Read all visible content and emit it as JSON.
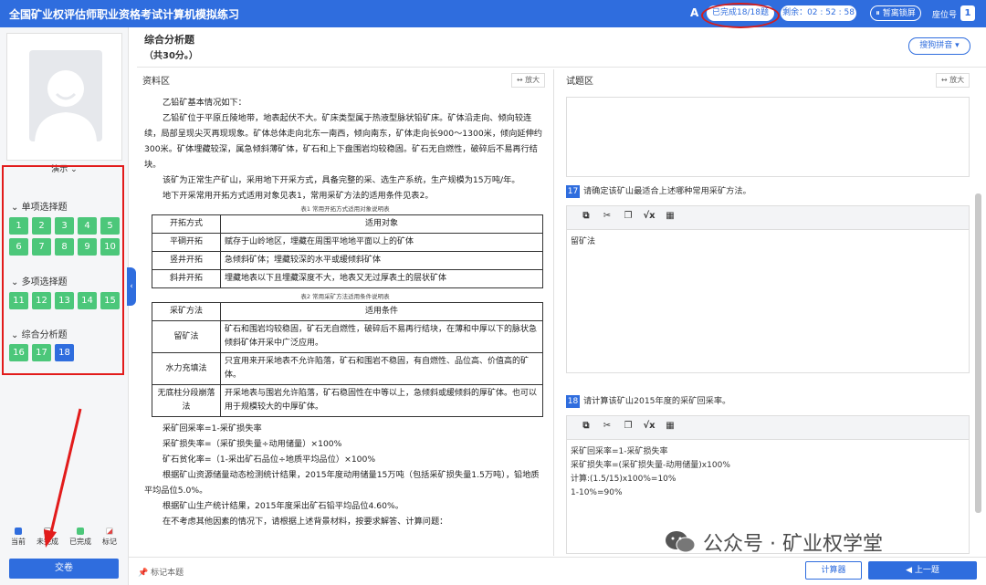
{
  "header": {
    "title": "全国矿业权评估师职业资格考试计算机模拟练习",
    "font_icon": "A",
    "progress": "已完成18/18题",
    "timer": "剩余：02 : 52 : 58",
    "pause": "暂离锁屏",
    "seat_label": "座位号",
    "seat_number": "1"
  },
  "sidebar": {
    "user_name": "演示",
    "sections": [
      {
        "title": "单项选择题",
        "items": [
          "1",
          "2",
          "3",
          "4",
          "5",
          "6",
          "7",
          "8",
          "9",
          "10"
        ]
      },
      {
        "title": "多项选择题",
        "items": [
          "11",
          "12",
          "13",
          "14",
          "15"
        ]
      },
      {
        "title": "综合分析题",
        "items": [
          "16",
          "17",
          "18"
        ]
      }
    ],
    "current_item": "18",
    "legend": [
      "当前",
      "未完成",
      "已完成",
      "标记"
    ],
    "submit": "交卷",
    "colors": {
      "current": "#2f6dde",
      "done": "#4cc77a",
      "highlight": "#e21b1b"
    }
  },
  "question_header": {
    "type": "综合分析题",
    "score": "（共30分。）",
    "ime": "搜狗拼音"
  },
  "material": {
    "label": "资料区",
    "zoom": "放大",
    "paragraphs": [
      "乙铅矿基本情况如下：",
      "乙铅矿位于平原丘陵地带，地表起伏不大。矿床类型属于热液型脉状铅矿床。矿体沿走向、倾向较连续，局部呈现尖灭再现现象。矿体总体走向北东一南西，倾向南东，矿体走向长900～1300米，倾向延伸约300米。矿体埋藏较深，属急倾斜薄矿体，矿石和上下盘围岩均较稳固。矿石无自燃性，破碎后不易再行结块。",
      "该矿为正常生产矿山，采用地下开采方式，具备完整的采、选生产系统，生产规模为15万吨/年。",
      "地下开采常用开拓方式适用对象见表1，常用采矿方法的适用条件见表2。"
    ],
    "table1": {
      "caption": "表1  常用开拓方式适用对象说明表",
      "headers": [
        "开拓方式",
        "适用对象"
      ],
      "rows": [
        [
          "平硐开拓",
          "赋存于山岭地区，埋藏在周围平地地平面以上的矿体"
        ],
        [
          "竖井开拓",
          "急倾斜矿体；埋藏较深的水平或缓倾斜矿体"
        ],
        [
          "斜井开拓",
          "埋藏地表以下且埋藏深度不大，地表又无过厚表土的层状矿体"
        ]
      ]
    },
    "table2": {
      "caption": "表2  常用采矿方法适用条件说明表",
      "headers": [
        "采矿方法",
        "适用条件"
      ],
      "rows": [
        [
          "留矿法",
          "矿石和围岩均较稳固，矿石无自燃性，破碎后不易再行结块，在薄和中厚以下的脉状急倾斜矿体开采中广泛应用。"
        ],
        [
          "水力充填法",
          "只宜用来开采地表不允许陷落，矿石和围岩不稳固，有自燃性、品位高、价值高的矿体。"
        ],
        [
          "无底柱分段崩落法",
          "开采地表与围岩允许陷落，矿石稳固性在中等以上，急倾斜或缓倾斜的厚矿体。也可以用于规模较大的中厚矿体。"
        ]
      ]
    },
    "formulas": [
      "采矿回采率=1-采矿损失率",
      "采矿损失率=（采矿损失量÷动用储量）×100%",
      "矿石贫化率=（1-采出矿石品位÷地质平均品位）×100%"
    ],
    "after": [
      "根据矿山资源储量动态检测统计结果，2015年度动用储量15万吨（包括采矿损失量1.5万吨），铅地质平均品位5.0%。",
      "根据矿山生产统计结果，2015年度采出矿石铅平均品位4.60%。",
      "在不考虑其他因素的情况下，请根据上述背景材料，按要求解答、计算问题："
    ]
  },
  "questions_panel": {
    "label": "试题区",
    "zoom": "放大",
    "q17": {
      "num": "17",
      "text": "请确定该矿山最适合上述哪种常用采矿方法。",
      "answer": "留矿法"
    },
    "q18": {
      "num": "18",
      "text": "请计算该矿山2015年度的采矿回采率。",
      "answer_lines": [
        "采矿回采率=1-采矿损失率",
        "采矿损失率=(采矿损失量-动用储量)x100%",
        "计算:(1.5/15)x100%=10%",
        "1-10%=90%"
      ]
    },
    "toolbar_icons": [
      "copy-icon",
      "cut-icon",
      "paste-icon",
      "sqrt-icon",
      "table-icon"
    ]
  },
  "footer": {
    "mark": "标记本题",
    "calculator": "计算器",
    "prev": "上一题",
    "watermark": "公众号 · 矿业权学堂"
  }
}
